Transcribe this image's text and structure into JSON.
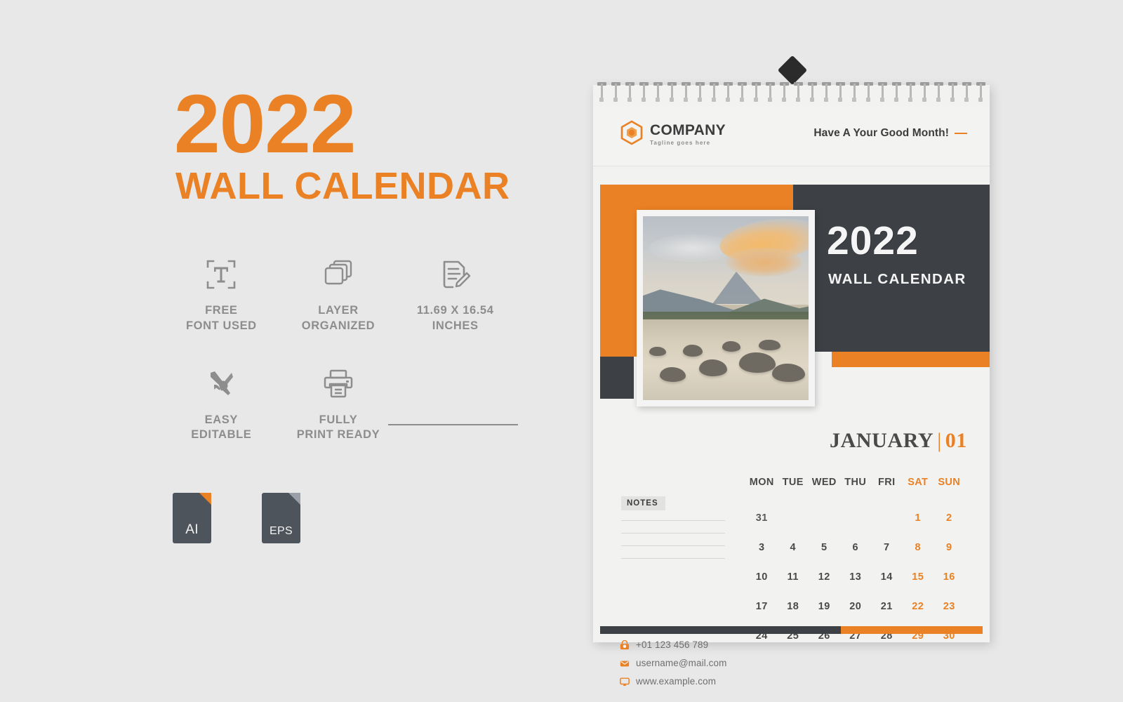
{
  "promo": {
    "year": "2022",
    "subtitle": "WALL CALENDAR",
    "features": [
      {
        "icon": "text-font-icon",
        "label": "FREE\nFONT USED"
      },
      {
        "icon": "layers-icon",
        "label": "LAYER\nORGANIZED"
      },
      {
        "icon": "document-edit-icon",
        "label": "11.69 X 16.54\nINCHES"
      },
      {
        "icon": "tools-icon",
        "label": "EASY\nEDITABLE"
      },
      {
        "icon": "printer-icon",
        "label": "FULLY\nPRINT READY"
      }
    ],
    "filetypes": [
      {
        "name": "AI",
        "icon": "ai-file-icon"
      },
      {
        "name": "EPS",
        "icon": "eps-file-icon"
      }
    ]
  },
  "calendar": {
    "brand": {
      "logo_icon": "hexagon-logo-icon",
      "name": "COMPANY",
      "tagline": "Tagline goes here"
    },
    "header_message": "Have A Your Good Month!",
    "cover": {
      "year": "2022",
      "subtitle": "WALL CALENDAR",
      "photo_alt": "mountain-river-landscape"
    },
    "month": {
      "name": "JANUARY",
      "separator": "|",
      "number": "01"
    },
    "notes": {
      "title": "NOTES",
      "line_count": 4
    },
    "contacts": [
      {
        "icon": "phone-icon",
        "text": "+01 123 456 789"
      },
      {
        "icon": "mail-icon",
        "text": "username@mail.com"
      },
      {
        "icon": "monitor-icon",
        "text": "www.example.com"
      }
    ],
    "grid": {
      "day_headers": [
        "MON",
        "TUE",
        "WED",
        "THU",
        "FRI",
        "SAT",
        "SUN"
      ],
      "weekend_headers": [
        "SAT",
        "SUN"
      ],
      "weeks": [
        [
          {
            "d": "31",
            "type": "off"
          },
          {
            "d": "",
            "type": "empty"
          },
          {
            "d": "",
            "type": "empty"
          },
          {
            "d": "",
            "type": "empty"
          },
          {
            "d": "",
            "type": "empty"
          },
          {
            "d": "1",
            "type": "we"
          },
          {
            "d": "2",
            "type": "we"
          }
        ],
        [
          {
            "d": "3",
            "type": "d"
          },
          {
            "d": "4",
            "type": "d"
          },
          {
            "d": "5",
            "type": "d"
          },
          {
            "d": "6",
            "type": "d"
          },
          {
            "d": "7",
            "type": "d"
          },
          {
            "d": "8",
            "type": "we"
          },
          {
            "d": "9",
            "type": "we"
          }
        ],
        [
          {
            "d": "10",
            "type": "d"
          },
          {
            "d": "11",
            "type": "d"
          },
          {
            "d": "12",
            "type": "d"
          },
          {
            "d": "13",
            "type": "d"
          },
          {
            "d": "14",
            "type": "d"
          },
          {
            "d": "15",
            "type": "we"
          },
          {
            "d": "16",
            "type": "we"
          }
        ],
        [
          {
            "d": "17",
            "type": "d"
          },
          {
            "d": "18",
            "type": "d"
          },
          {
            "d": "19",
            "type": "d"
          },
          {
            "d": "20",
            "type": "d"
          },
          {
            "d": "21",
            "type": "d"
          },
          {
            "d": "22",
            "type": "we"
          },
          {
            "d": "23",
            "type": "we"
          }
        ],
        [
          {
            "d": "24",
            "type": "d"
          },
          {
            "d": "25",
            "type": "d"
          },
          {
            "d": "26",
            "type": "d"
          },
          {
            "d": "27",
            "type": "d"
          },
          {
            "d": "28",
            "type": "d"
          },
          {
            "d": "29",
            "type": "we"
          },
          {
            "d": "30",
            "type": "we"
          }
        ]
      ]
    },
    "hanger_icon": "nail-hanger-icon",
    "binding_icon": "spiral-binding-icon",
    "coil_count": 28
  },
  "colors": {
    "accent_orange": "#ea8124",
    "dark_slate": "#3d4045",
    "page_bg": "#e8e8e8",
    "calendar_bg": "#f2f2f1",
    "muted_gray": "#8d8d8d",
    "text_dark": "#4a4a4a"
  }
}
